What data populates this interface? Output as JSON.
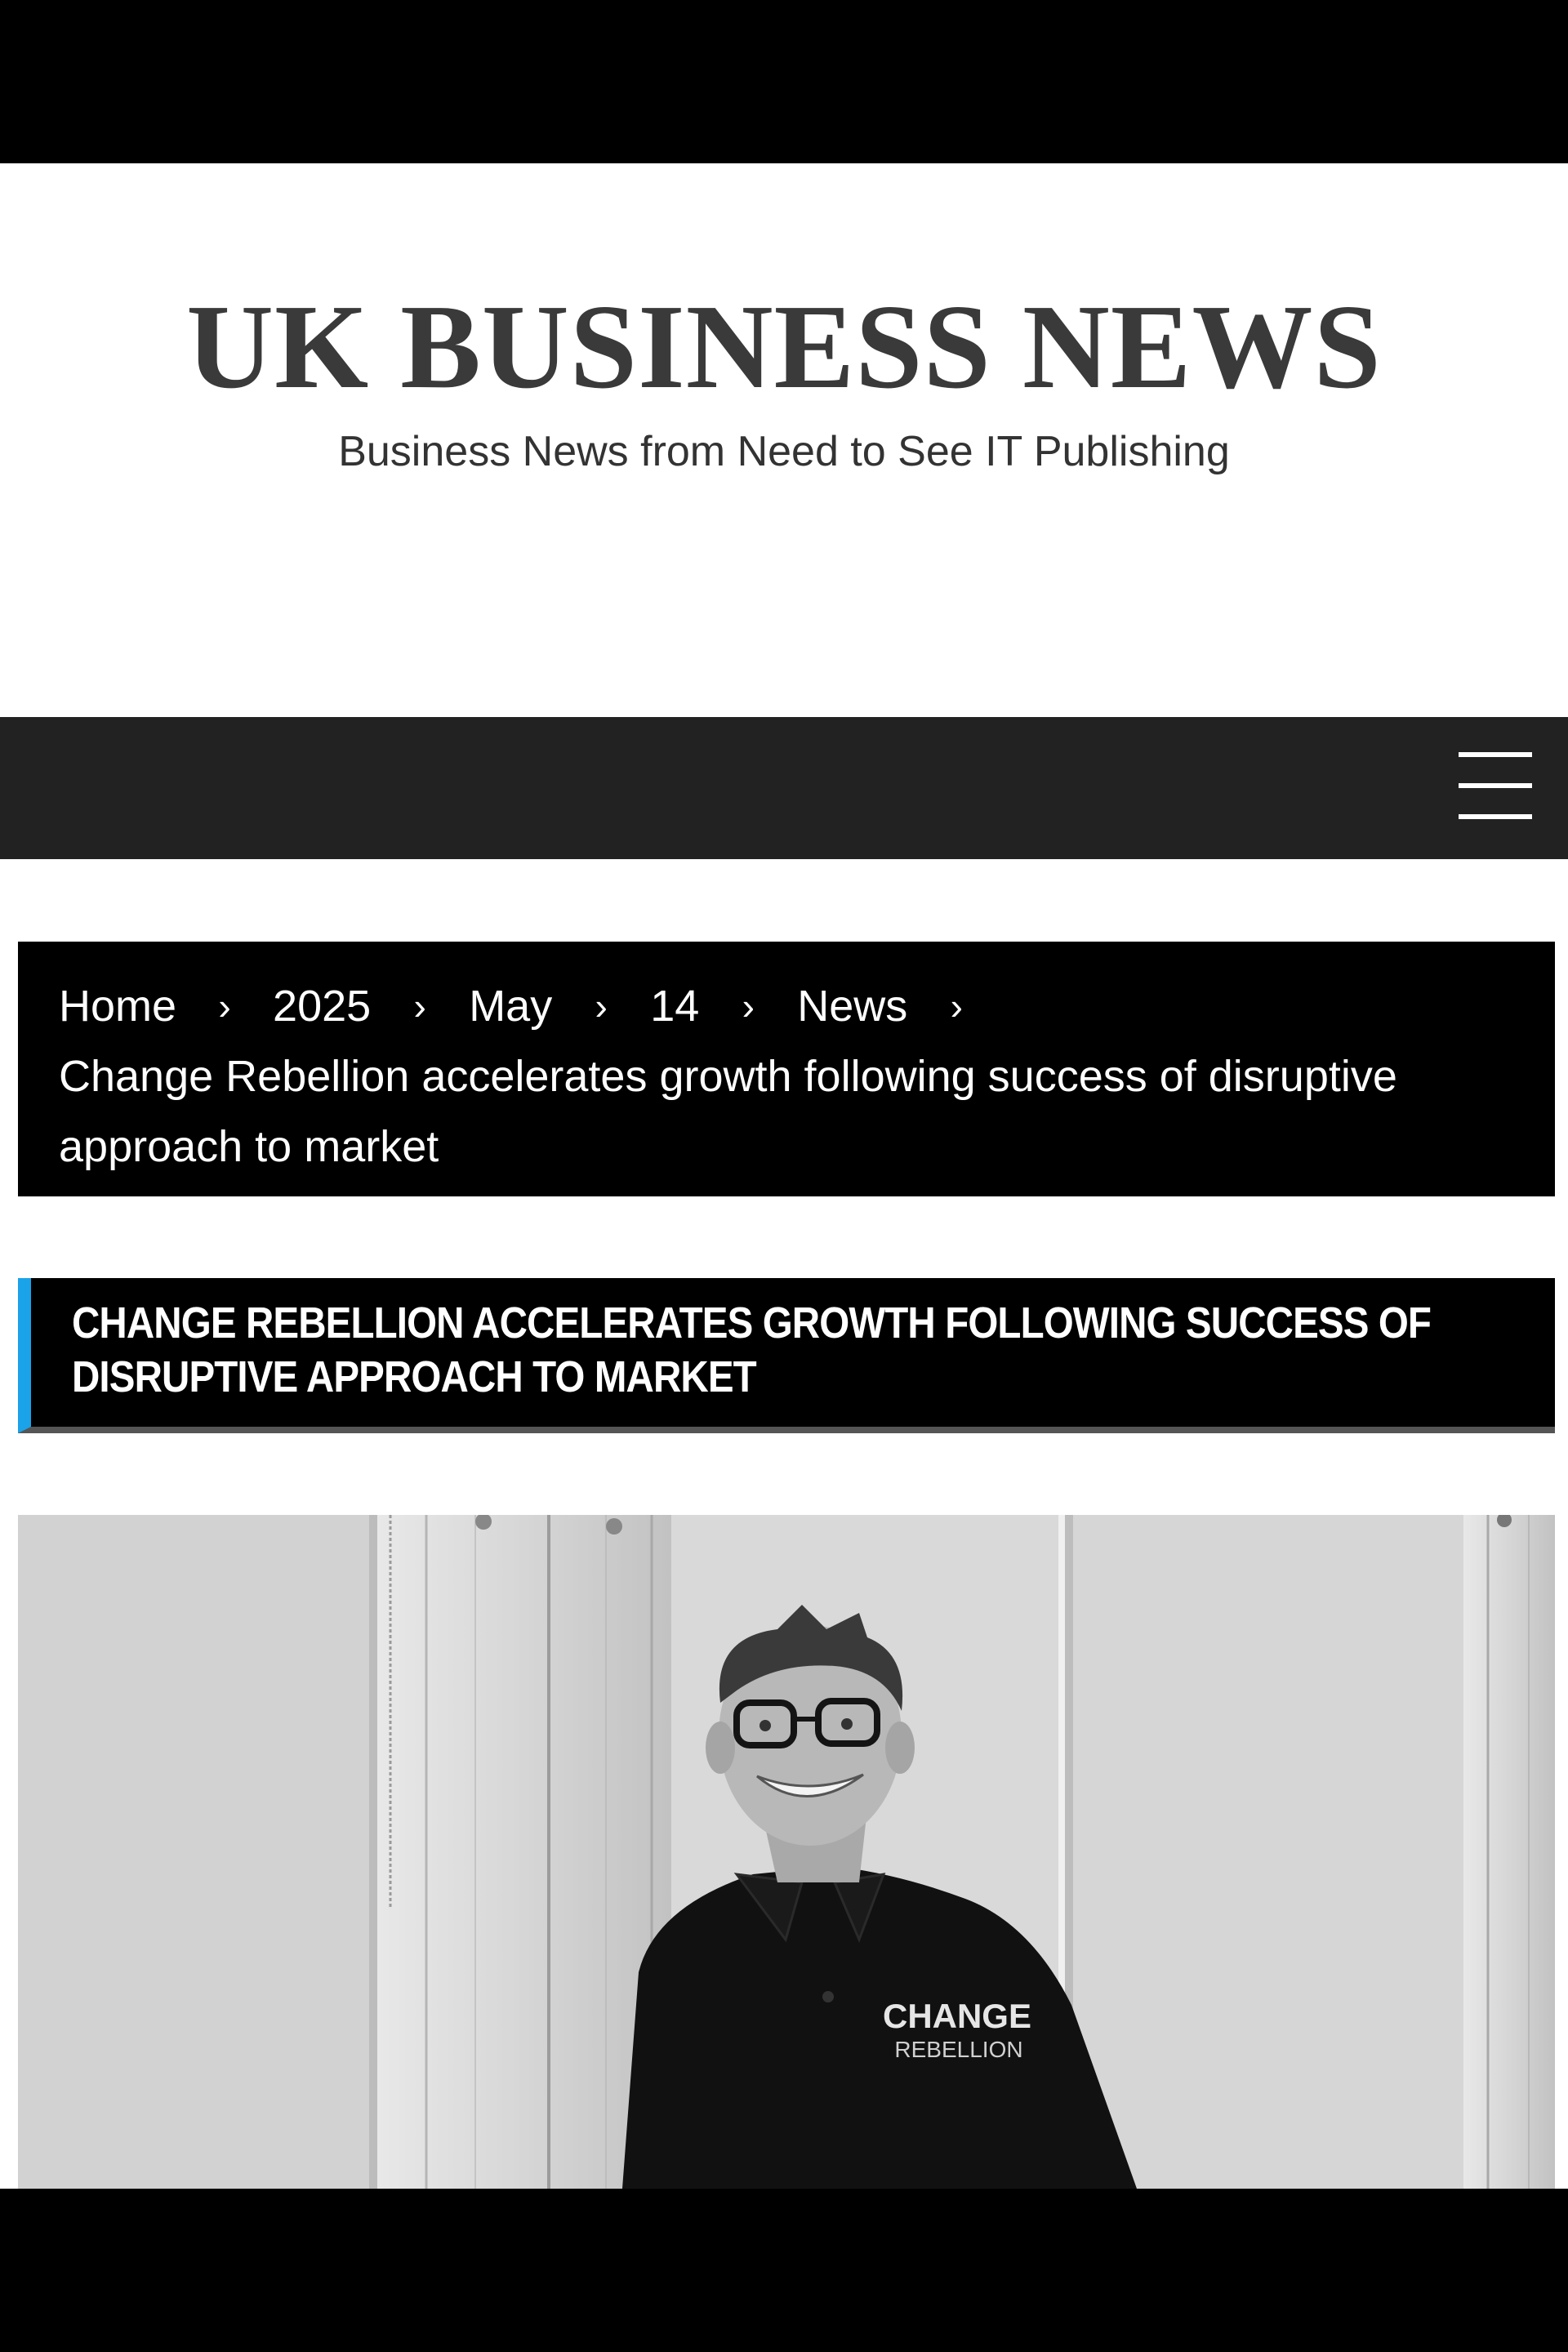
{
  "site": {
    "title": "UK BUSINESS NEWS",
    "tagline": "Business News from Need to See IT Publishing"
  },
  "nav": {
    "menu_icon": "hamburger-menu-icon"
  },
  "breadcrumb": {
    "items": [
      "Home",
      "2025",
      "May",
      "14",
      "News"
    ],
    "separator": "›",
    "current": "Change Rebellion accelerates growth following success of disruptive approach to market"
  },
  "article": {
    "title": "Change Rebellion accelerates growth following success of disruptive approach to market",
    "image": {
      "shirt_text_line1": "CHANGE",
      "shirt_text_line2": "REBELLION"
    }
  },
  "colors": {
    "accent": "#1aa3e8",
    "nav_background": "#222222",
    "title_color": "#3a3a3a"
  }
}
